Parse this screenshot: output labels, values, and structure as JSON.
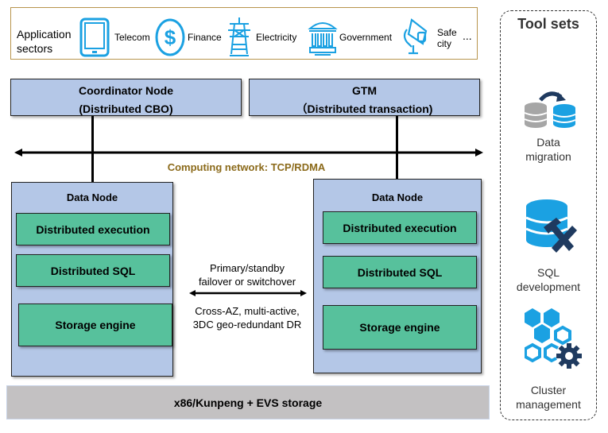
{
  "sectors": {
    "label": "Application sectors",
    "items": [
      {
        "icon": "tablet-icon",
        "label": "Telecom"
      },
      {
        "icon": "dollar-icon",
        "label": "Finance"
      },
      {
        "icon": "power-tower-icon",
        "label": "Electricity"
      },
      {
        "icon": "government-building-icon",
        "label": "Government"
      },
      {
        "icon": "security-camera-icon",
        "label": "Safe city"
      }
    ],
    "more": "..."
  },
  "coordinator": {
    "title": "Coordinator Node",
    "subtitle": "(Distributed CBO)"
  },
  "gtm": {
    "title": "GTM",
    "subtitle": "（Distributed transaction)"
  },
  "network": {
    "label": "Computing network: TCP/RDMA"
  },
  "data_nodes": [
    {
      "title": "Data Node",
      "layers": [
        "Distributed execution",
        "Distributed SQL",
        "Storage engine"
      ]
    },
    {
      "title": "Data Node",
      "layers": [
        "Distributed execution",
        "Distributed SQL",
        "Storage engine"
      ]
    }
  ],
  "replication": {
    "top": "Primary/standby failover or switchover",
    "bottom_line1": "Cross-AZ, multi-active,",
    "bottom_line2": "3DC geo-redundant DR",
    "top_line1": "Primary/standby",
    "top_line2": "failover or switchover"
  },
  "base": {
    "label": "x86/Kunpeng + EVS storage"
  },
  "tools": {
    "title": "Tool sets",
    "items": [
      {
        "icon": "data-migration-icon",
        "line1": "Data",
        "line2": "migration"
      },
      {
        "icon": "sql-development-icon",
        "line1": "SQL",
        "line2": "development"
      },
      {
        "icon": "cluster-management-icon",
        "line1": "Cluster",
        "line2": "management"
      }
    ]
  },
  "colors": {
    "node_blue": "#b4c7e7",
    "layer_green": "#57c19c",
    "network_label": "#8b6a1a",
    "icon_blue": "#1ba1e2",
    "icon_dark": "#1f3a5f",
    "base_gray": "#c3c1c2"
  }
}
